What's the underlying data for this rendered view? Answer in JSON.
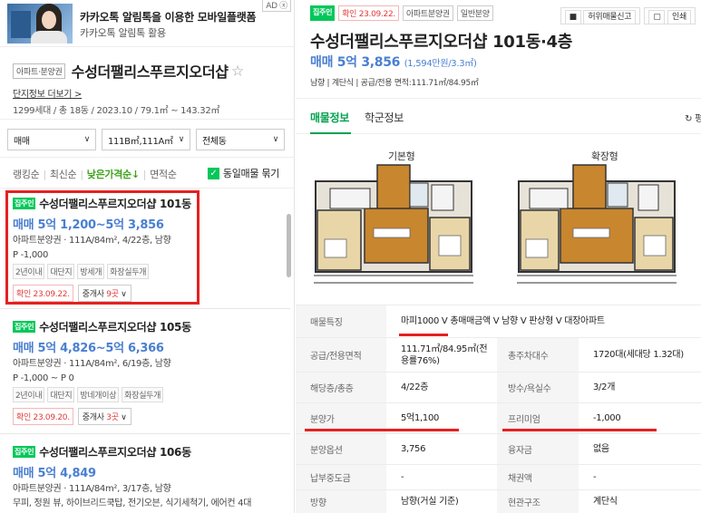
{
  "ad": {
    "badge": "AD ⓧ",
    "title": "카카오톡 알림톡을 이용한 모바일플랫폼",
    "subtitle": "카카오톡 알림톡 활용"
  },
  "complex": {
    "tag": "아파트·분양권",
    "name": "수성더팰리스푸르지오더샵",
    "star": "☆",
    "more_link": "단지정보 더보기 >",
    "info": "1299세대 / 총 18동 / 2023.10 / 79.1㎡ ~ 143.32㎡"
  },
  "filters": [
    {
      "label": "매매",
      "arrow": "∨"
    },
    {
      "label": "111B㎡,111A㎡",
      "arrow": "∨"
    },
    {
      "label": "전체동",
      "arrow": "∨"
    }
  ],
  "sort": {
    "items": [
      "랭킹순",
      "최신순",
      "낮은가격순↓",
      "면적순"
    ],
    "active_index": 2,
    "same_listing_label": "동일매물 묶기",
    "check": "✓"
  },
  "listings": [
    {
      "badge": "집주인",
      "title": "수성더팰리스푸르지오더샵 101동",
      "price": "매매 5억 1,200~5억 3,856",
      "line1": "아파트분양권 · 111A/84m², 4/22층, 남향",
      "line2": "P -1,000",
      "tags": [
        "2년이내",
        "대단지",
        "방세개",
        "화장실두개"
      ],
      "confirm": "확인 23.09.22.",
      "broker_label": "중개사",
      "broker_count": "9곳",
      "broker_arrow": "∨"
    },
    {
      "badge": "집주인",
      "title": "수성더팰리스푸르지오더샵 105동",
      "price": "매매 5억 4,826~5억 6,366",
      "line1": "아파트분양권 · 111A/84m², 6/19층, 남향",
      "line2": "P -1,000 ~ P 0",
      "tags": [
        "2년이내",
        "대단지",
        "방네개이상",
        "화장실두개"
      ],
      "confirm": "확인 23.09.20.",
      "broker_label": "중개사",
      "broker_count": "3곳",
      "broker_arrow": "∨"
    },
    {
      "badge": "집주인",
      "title": "수성더팰리스푸르지오더샵 106동",
      "price": "매매 5억 4,849",
      "line1": "아파트분양권 · 111A/84m², 3/17층, 남향",
      "line2": "무피, 정원 뷰, 하이브리드쿡탑, 전기오븐, 식기세척기, 에어컨 4대"
    }
  ],
  "detail": {
    "badge": "집주인",
    "confirm": "확인 23.09.22.",
    "type": "아파트분양권",
    "category": "일반분양",
    "report_button": "허위매물신고",
    "print_button": "인쇄",
    "title": "수성더팰리스푸르지오더샵 101동·4층",
    "price": "매매 5억 3,856",
    "price_per": "(1,594만원/3.3㎡)",
    "sub": "남향 | 계단식 | 공급/전용 면적:111.71㎡/84.95㎡",
    "tabs": [
      "매물정보",
      "학군정보"
    ],
    "refresh": "↻ 평",
    "plans": [
      "기본형",
      "확장형"
    ],
    "rows": [
      {
        "label": "매물특징",
        "value": "마피1000 V 총매매금액 V 남향 V 판상형 V 대장아파트"
      },
      {
        "label": "공급/전용면적",
        "value": "111.71㎡/84.95㎡(전용률76%)",
        "label2": "총주차대수",
        "value2": "1720대(세대당 1.32대)"
      },
      {
        "label": "해당층/총층",
        "value": "4/22층",
        "label2": "방수/욕실수",
        "value2": "3/2개"
      },
      {
        "label": "분양가",
        "value": "5억1,100",
        "label2": "프리미엄",
        "value2": "-1,000"
      },
      {
        "label": "분양옵션",
        "value": "3,756",
        "label2": "융자금",
        "value2": "없음"
      },
      {
        "label": "납부중도금",
        "value": "-",
        "label2": "채권액",
        "value2": "-"
      },
      {
        "label": "방향",
        "value": "남향(거실 기준)",
        "label2": "현관구조",
        "value2": "계단식"
      }
    ]
  }
}
